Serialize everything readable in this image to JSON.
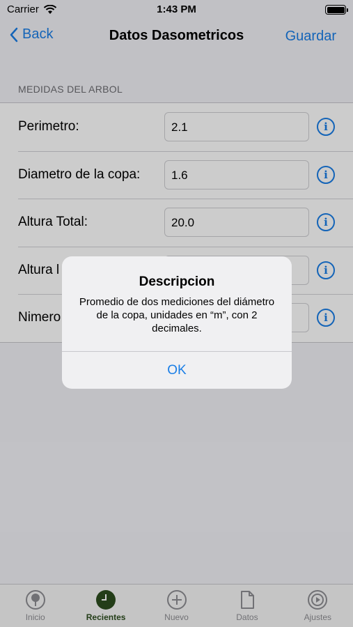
{
  "status": {
    "carrier": "Carrier",
    "time": "1:43 PM"
  },
  "nav": {
    "back_label": "Back",
    "title": "Datos Dasometricos",
    "save_label": "Guardar"
  },
  "section": {
    "header": "MEDIDAS DEL ARBOL"
  },
  "rows": [
    {
      "label": "Perimetro:",
      "value": "2.1"
    },
    {
      "label": "Diametro de la copa:",
      "value": "1.6"
    },
    {
      "label": "Altura Total:",
      "value": "20.0"
    },
    {
      "label": "Altura l",
      "value": ""
    },
    {
      "label": "Nimero",
      "value": ""
    }
  ],
  "alert": {
    "title": "Descripcion",
    "message": "Promedio de dos mediciones del diámetro de la copa, unidades en “m”, con 2 decimales.",
    "ok_label": "OK"
  },
  "tabs": [
    {
      "label": "Inicio",
      "icon": "tree-icon"
    },
    {
      "label": "Recientes",
      "icon": "clock-icon",
      "active": true
    },
    {
      "label": "Nuevo",
      "icon": "plus-circle-icon"
    },
    {
      "label": "Datos",
      "icon": "document-icon"
    },
    {
      "label": "Ajustes",
      "icon": "settings-icon"
    }
  ],
  "colors": {
    "accent": "#1a7ee6",
    "active_tab": "#2c4d1e"
  }
}
